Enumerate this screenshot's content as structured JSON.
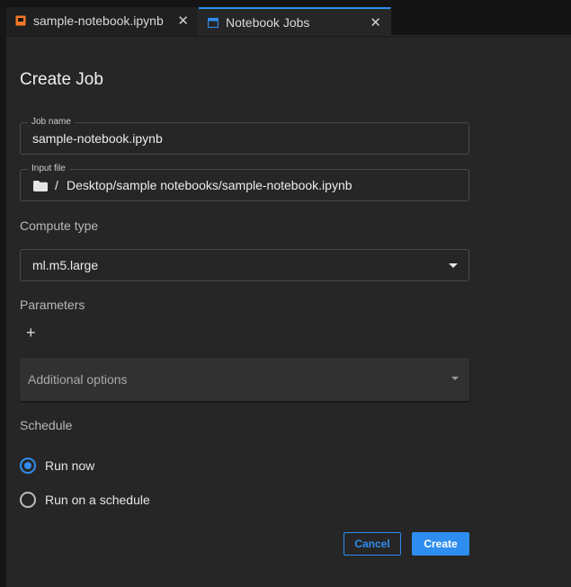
{
  "tabs": [
    {
      "label": "sample-notebook.ipynb",
      "icon": "notebook-icon",
      "close": "✕",
      "icon_color": "#f37726"
    },
    {
      "label": "Notebook Jobs",
      "icon": "calendar-icon",
      "close": "✕",
      "icon_color": "#2f8df0",
      "active": true
    }
  ],
  "page": {
    "title": "Create Job"
  },
  "form": {
    "job_name": {
      "label": "Job name",
      "value": "sample-notebook.ipynb"
    },
    "input_file": {
      "label": "Input file",
      "separator": "/",
      "value": "Desktop/sample notebooks/sample-notebook.ipynb"
    },
    "compute_type": {
      "label": "Compute type",
      "selected": "ml.m5.large"
    },
    "parameters": {
      "label": "Parameters",
      "add": "+"
    },
    "additional_options": {
      "label": "Additional options"
    },
    "schedule": {
      "label": "Schedule",
      "options": [
        {
          "label": "Run now",
          "checked": true
        },
        {
          "label": "Run on a schedule",
          "checked": false
        }
      ]
    }
  },
  "actions": {
    "cancel": "Cancel",
    "create": "Create"
  },
  "colors": {
    "accent": "#2f8df0",
    "background": "#262626"
  }
}
